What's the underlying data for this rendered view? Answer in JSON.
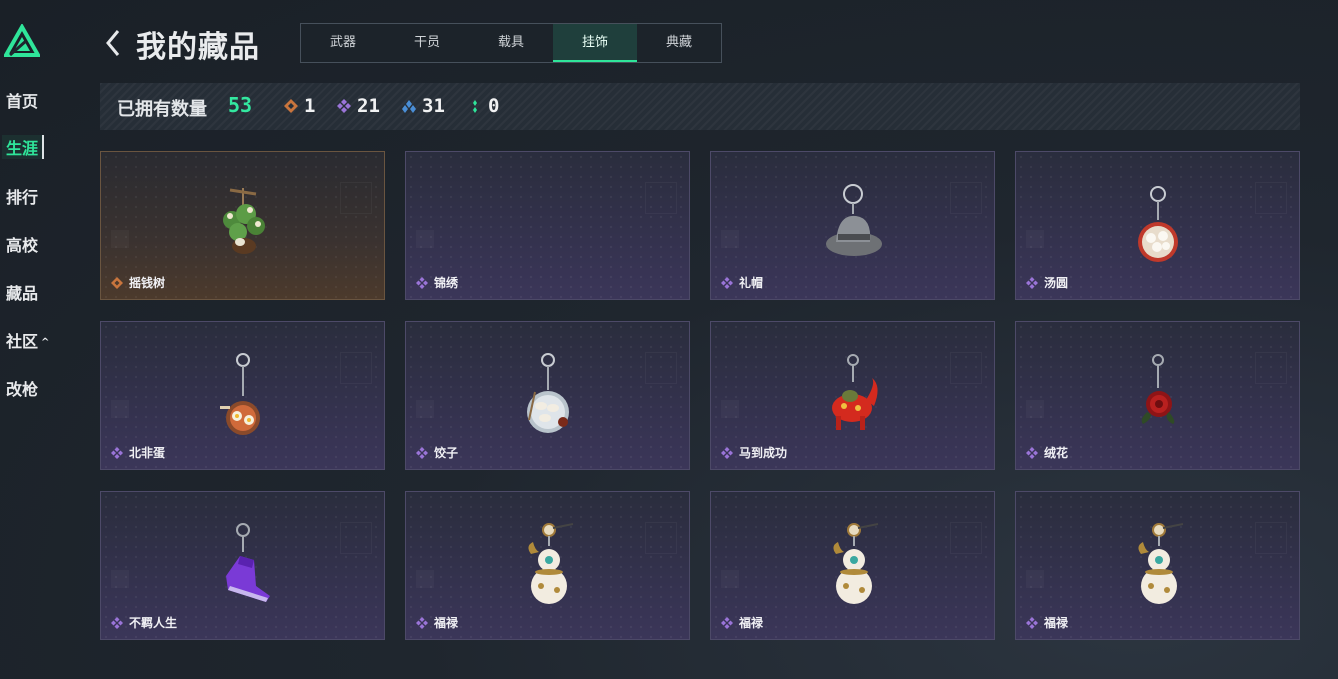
{
  "sidebar": {
    "items": [
      {
        "label": "首页",
        "active": false
      },
      {
        "label": "生涯",
        "active": true
      },
      {
        "label": "排行",
        "active": false
      },
      {
        "label": "高校",
        "active": false
      },
      {
        "label": "藏品",
        "active": false
      },
      {
        "label": "社区",
        "active": false,
        "caret": "^"
      },
      {
        "label": "改枪",
        "active": false
      }
    ]
  },
  "header": {
    "back_icon": "chevron-left-icon",
    "title": "我的藏品",
    "tabs": [
      {
        "label": "武器",
        "active": false
      },
      {
        "label": "干员",
        "active": false
      },
      {
        "label": "载具",
        "active": false
      },
      {
        "label": "挂饰",
        "active": true
      },
      {
        "label": "典藏",
        "active": false
      }
    ]
  },
  "stats": {
    "owned_label": "已拥有数量",
    "owned_total": "53",
    "rarity_counts": [
      {
        "icon": "diamond-orange-icon",
        "color": "#c9753d",
        "count": "1"
      },
      {
        "icon": "diamond-purple-icon",
        "color": "#9a74d8",
        "count": "21"
      },
      {
        "icon": "diamond-blue-icon",
        "color": "#4a8ed6",
        "count": "31"
      },
      {
        "icon": "diamond-green-icon",
        "color": "#2fe59a",
        "count": "0"
      }
    ]
  },
  "items": [
    {
      "name": "摇钱树",
      "rarity": "orange",
      "icon": "money-tree-charm-icon"
    },
    {
      "name": "锦绣",
      "rarity": "purple",
      "icon": ""
    },
    {
      "name": "礼帽",
      "rarity": "purple",
      "icon": "hat-charm-icon"
    },
    {
      "name": "汤圆",
      "rarity": "purple",
      "icon": "tangyuan-charm-icon"
    },
    {
      "name": "北非蛋",
      "rarity": "purple",
      "icon": "shakshuka-charm-icon"
    },
    {
      "name": "饺子",
      "rarity": "purple",
      "icon": "dumpling-charm-icon"
    },
    {
      "name": "马到成功",
      "rarity": "purple",
      "icon": "red-horse-charm-icon"
    },
    {
      "name": "绒花",
      "rarity": "purple",
      "icon": "rose-charm-icon"
    },
    {
      "name": "不羁人生",
      "rarity": "purple",
      "icon": "sneaker-charm-icon"
    },
    {
      "name": "福禄",
      "rarity": "purple",
      "icon": "gourd-charm-icon"
    },
    {
      "name": "福禄",
      "rarity": "purple",
      "icon": "gourd-charm-icon"
    },
    {
      "name": "福禄",
      "rarity": "purple",
      "icon": "gourd-charm-icon"
    }
  ],
  "colors": {
    "accent": "#2fe59a",
    "rarity_orange": "#c9753d",
    "rarity_purple": "#9a74d8"
  }
}
